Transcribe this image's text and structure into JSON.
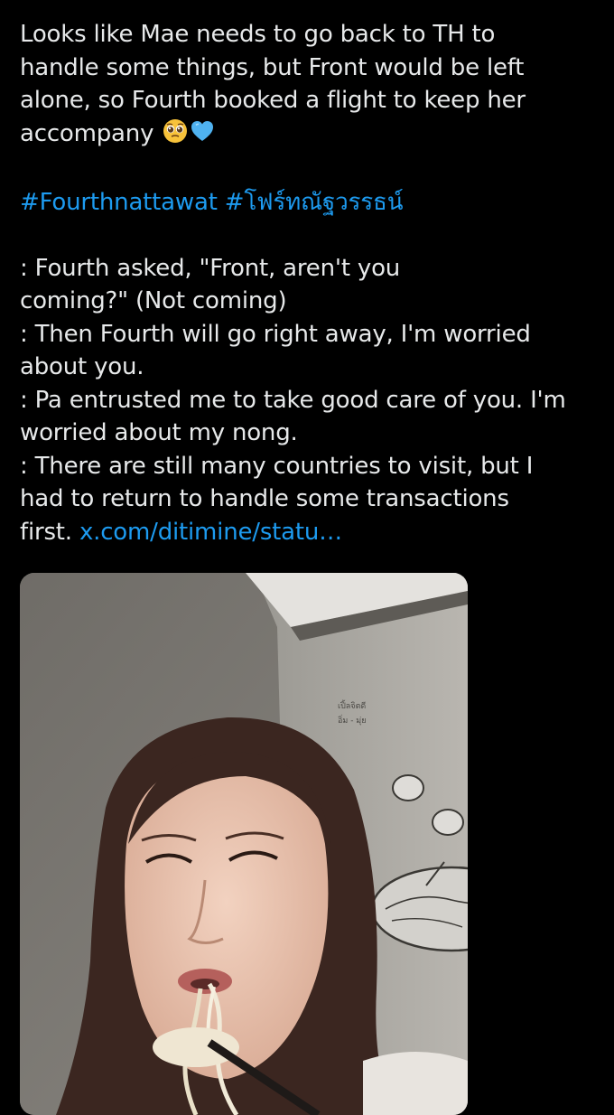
{
  "tweet": {
    "lines": [
      "Looks like Mae needs to go back to TH to",
      "handle some things, but Front would be left",
      "alone, so Fourth booked a flight to keep her",
      "accompany"
    ],
    "emojis": [
      "pleading-face-emoji",
      "blue-heart-emoji"
    ],
    "hashtags": [
      "#Fourthnattawat",
      "#โฟร์ทณัฐวรรธน์"
    ],
    "body_lines": [
      ": Fourth asked, \"Front, aren't you",
      "coming?\" (Not coming)",
      ": Then Fourth will go right away, I'm worried",
      "about you.",
      ": Pa entrusted me to take good care of you. I'm",
      "worried about my nong.",
      ": There are still many countries to visit, but I",
      "had to return to handle some transactions"
    ],
    "last_line_text": "first.",
    "link_text": "x.com/ditimine/statu…"
  },
  "media": {
    "wall_text_line1": "เปิ้ลจิตดี",
    "wall_text_line2": "อิ่ม - มุ่ย"
  },
  "colors": {
    "background": "#000000",
    "text": "#e7e9ea",
    "link": "#1d9bf0"
  }
}
